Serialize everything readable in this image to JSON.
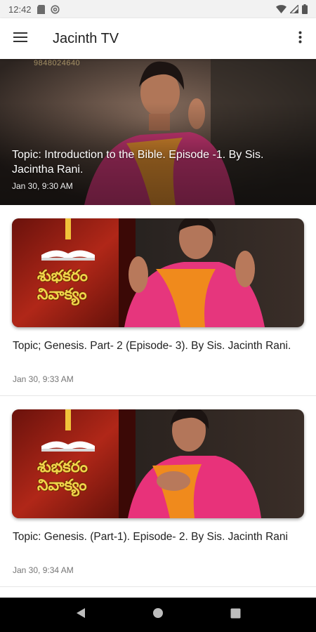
{
  "status_bar": {
    "time": "12:42",
    "left_icons": [
      "sd-card-icon",
      "at-sign-icon"
    ],
    "right_icons": [
      "wifi-icon",
      "signal-icon",
      "battery-icon"
    ]
  },
  "app_bar": {
    "title": "Jacinth TV",
    "menu_icon": "hamburger-menu-icon",
    "overflow_icon": "more-vert-icon"
  },
  "hero": {
    "title": "Topic: Introduction to the Bible. Episode -1. By Sis. Jacintha Rani.",
    "date": "Jan 30, 9:30 AM",
    "image_text": "9848024640"
  },
  "cards": [
    {
      "title": "Topic; Genesis. Part- 2 (Episode- 3). By Sis. Jacinth Rani.",
      "date": "Jan 30, 9:33 AM",
      "thumb_caption_line1": "శుభకరం",
      "thumb_caption_line2": "నివాక్యం"
    },
    {
      "title": "Topic: Genesis. (Part-1). Episode- 2. By Sis. Jacinth Rani",
      "date": "Jan 30, 9:34 AM",
      "thumb_caption_line1": "శుభకరం",
      "thumb_caption_line2": "నివాక్యం"
    }
  ],
  "nav_bar": {
    "back_icon": "back-triangle-icon",
    "home_icon": "home-circle-icon",
    "recents_icon": "recents-square-icon"
  },
  "colors": {
    "app_bar_bg": "#ffffff",
    "status_bar_bg": "#f2f2f2",
    "nav_bar_bg": "#000000",
    "thumb_red": "#8e1b12",
    "saree_pink": "#e8327a",
    "saree_orange": "#f08a1c"
  }
}
